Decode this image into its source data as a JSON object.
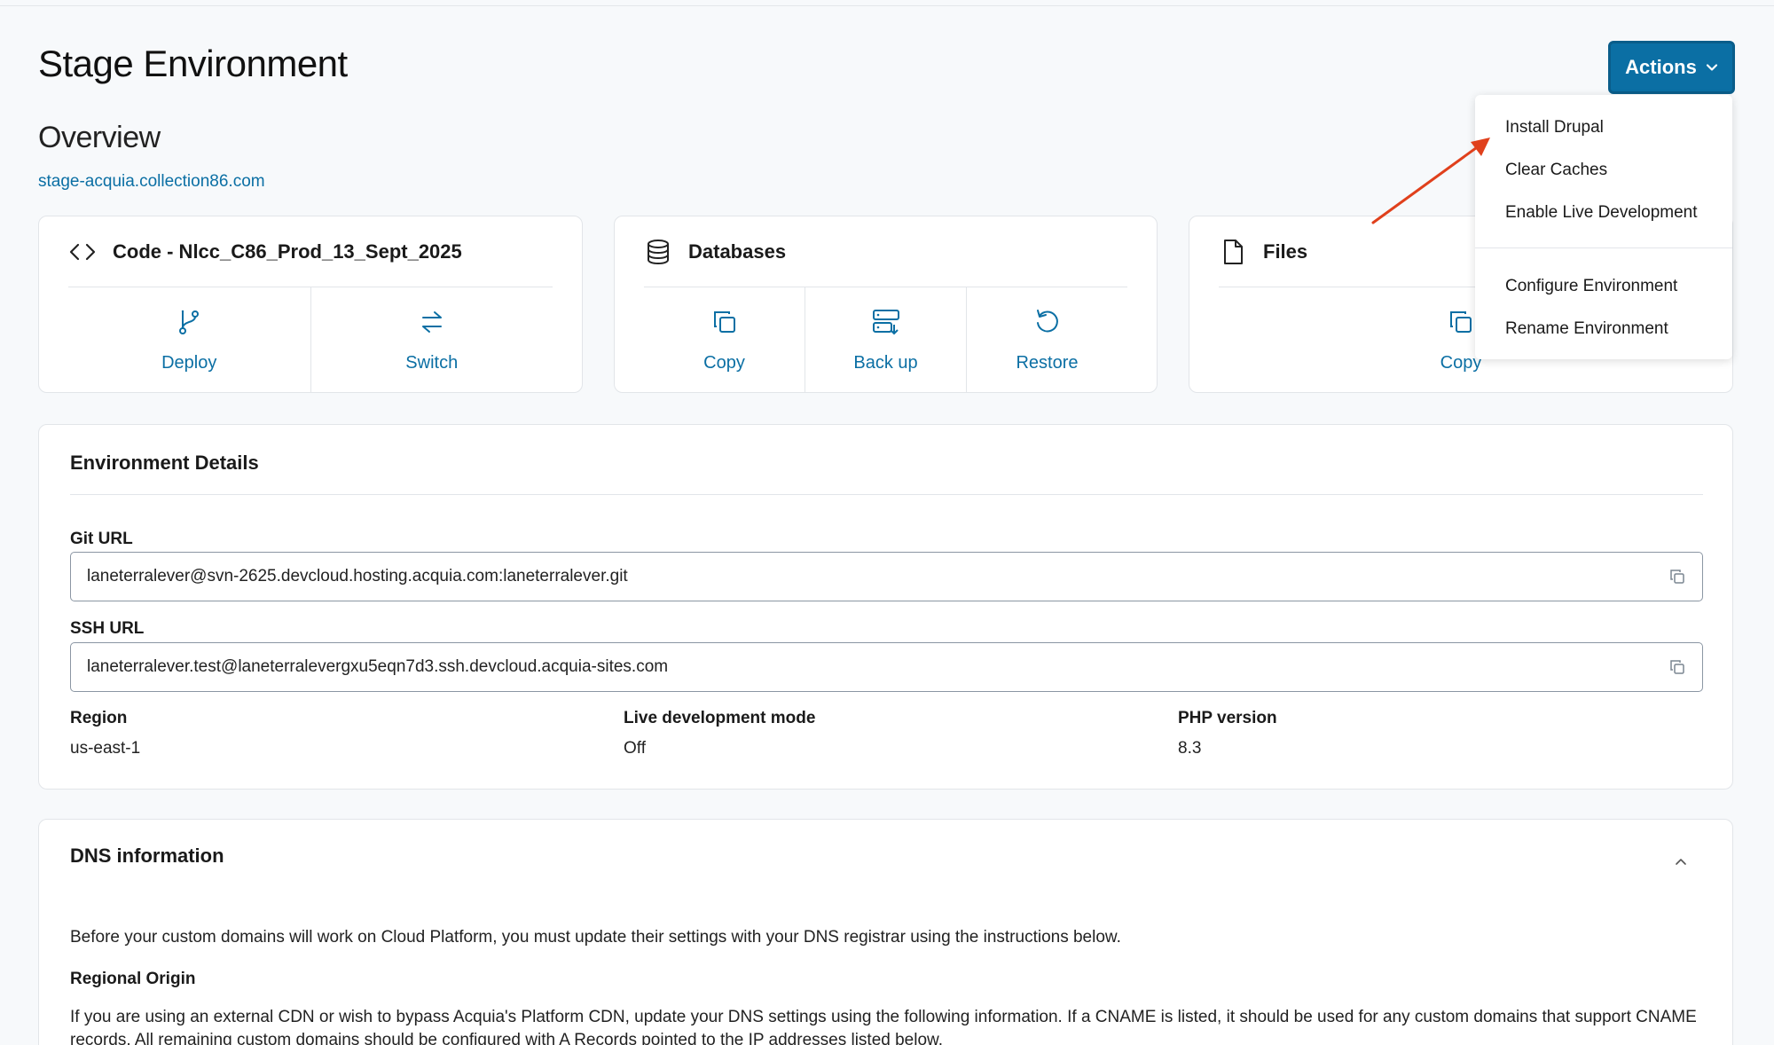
{
  "header": {
    "title": "Stage Environment",
    "subtitle": "Overview",
    "env_url": "stage-acquia.collection86.com",
    "actions_label": "Actions"
  },
  "cards": {
    "code": {
      "title": "Code - Nlcc_C86_Prod_13_Sept_2025",
      "actions": [
        {
          "label": "Deploy",
          "icon": "branch-icon"
        },
        {
          "label": "Switch",
          "icon": "swap-icon"
        }
      ]
    },
    "databases": {
      "title": "Databases",
      "actions": [
        {
          "label": "Copy",
          "icon": "copy-icon"
        },
        {
          "label": "Back up",
          "icon": "server-backup-icon"
        },
        {
          "label": "Restore",
          "icon": "restore-icon"
        }
      ]
    },
    "files": {
      "title": "Files",
      "actions": [
        {
          "label": "Copy",
          "icon": "copy-icon"
        }
      ]
    }
  },
  "details": {
    "title": "Environment Details",
    "git_label": "Git URL",
    "git_url": "laneterralever@svn-2625.devcloud.hosting.acquia.com:laneterralever.git",
    "ssh_label": "SSH URL",
    "ssh_url": "laneterralever.test@laneterralevergxu5eqn7d3.ssh.devcloud.acquia-sites.com",
    "region_label": "Region",
    "region": "us-east-1",
    "live_dev_label": "Live development mode",
    "live_dev": "Off",
    "php_label": "PHP version",
    "php": "8.3"
  },
  "dns": {
    "title": "DNS information",
    "intro": "Before your custom domains will work on Cloud Platform, you must update their settings with your DNS registrar using the instructions below.",
    "regional_heading": "Regional Origin",
    "regional_text": "If you are using an external CDN or wish to bypass Acquia's Platform CDN, update your DNS settings using the following information. If a CNAME is listed, it should be used for any custom domains that support CNAME records. All remaining custom domains should be configured with A Records pointed to the IP addresses listed below."
  },
  "actions_menu": {
    "items": [
      "Install Drupal",
      "Clear Caches",
      "Enable Live Development",
      "Configure Environment",
      "Rename Environment"
    ]
  },
  "colors": {
    "accent": "#0b6fa4",
    "annotation_arrow": "#e0401c"
  }
}
